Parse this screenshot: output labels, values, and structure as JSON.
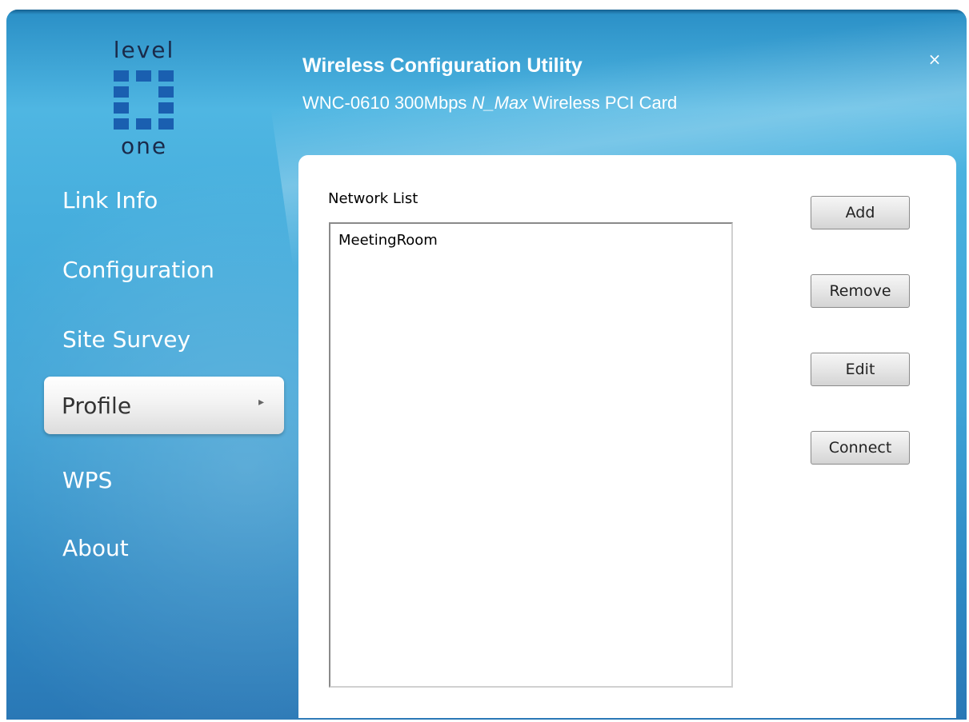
{
  "header": {
    "title": "Wireless Configuration Utility",
    "subtitle_prefix": "WNC-0610 300Mbps",
    "subtitle_italic": "N_Max",
    "subtitle_suffix": "Wireless PCI Card",
    "close_glyph": "×"
  },
  "logo": {
    "top_text": "level",
    "bottom_text": "one"
  },
  "sidebar": {
    "items": [
      {
        "label": "Link Info"
      },
      {
        "label": "Configuration"
      },
      {
        "label": "Site Survey"
      },
      {
        "label": "Profile",
        "active": true
      },
      {
        "label": "WPS"
      },
      {
        "label": "About"
      }
    ],
    "active_arrow": "▸"
  },
  "profile": {
    "network_list_label": "Network List",
    "networks": [
      "MeetingRoom"
    ],
    "buttons": {
      "add": "Add",
      "remove": "Remove",
      "edit": "Edit",
      "connect": "Connect"
    }
  }
}
